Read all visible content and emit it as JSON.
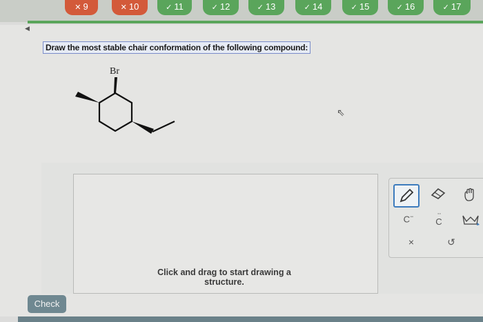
{
  "nav": {
    "items": [
      {
        "label": "9",
        "mark": "✕",
        "status": "wrong"
      },
      {
        "label": "10",
        "mark": "✕",
        "status": "wrong"
      },
      {
        "label": "11",
        "mark": "✓",
        "status": "correct"
      },
      {
        "label": "12",
        "mark": "✓",
        "status": "correct"
      },
      {
        "label": "13",
        "mark": "✓",
        "status": "correct"
      },
      {
        "label": "14",
        "mark": "✓",
        "status": "correct"
      },
      {
        "label": "15",
        "mark": "✓",
        "status": "correct"
      },
      {
        "label": "16",
        "mark": "✓",
        "status": "correct"
      },
      {
        "label": "17",
        "mark": "✓",
        "status": "correct"
      }
    ]
  },
  "question": {
    "prompt": "Draw the most stable chair conformation of the following compound:",
    "substituent_label": "Br"
  },
  "canvas": {
    "hint": "Click and drag to start drawing a structure."
  },
  "tools": {
    "pencil": "pencil-icon",
    "eraser": "eraser-icon",
    "hand": "hand-icon",
    "carbanion": "C",
    "carbanion_sup": "−",
    "carbene": "C",
    "carbene_dots": "··",
    "lasso": "lasso-icon",
    "clear": "×",
    "undo": "↺"
  },
  "check_label": "Check",
  "colors": {
    "correct": "#5aa55b",
    "wrong": "#d35a3a",
    "check_button": "#6f8891",
    "selected_tool": "#3c7bbd"
  }
}
